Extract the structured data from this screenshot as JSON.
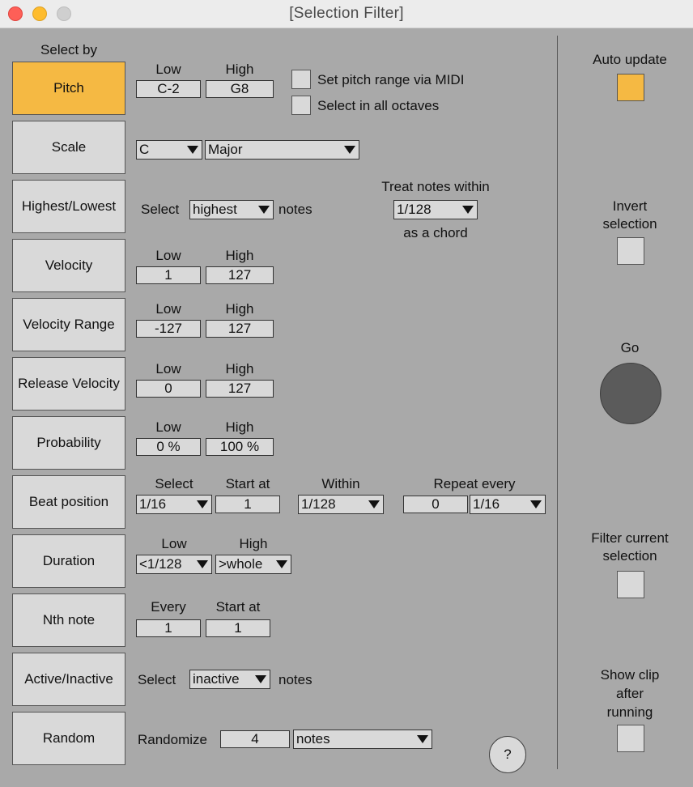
{
  "window": {
    "title": "[Selection Filter]"
  },
  "select_by_label": "Select by",
  "modes": {
    "pitch": "Pitch",
    "scale": "Scale",
    "highest_lowest": "Highest/Lowest",
    "velocity": "Velocity",
    "velocity_range": "Velocity Range",
    "release_velocity": "Release Velocity",
    "probability": "Probability",
    "beat_position": "Beat position",
    "duration": "Duration",
    "nth_note": "Nth note",
    "active_inactive": "Active/Inactive",
    "random": "Random"
  },
  "active_mode": "pitch",
  "labels": {
    "low": "Low",
    "high": "High",
    "select": "Select",
    "notes": "notes",
    "start_at": "Start at",
    "within": "Within",
    "repeat_every": "Repeat every",
    "every": "Every",
    "randomize": "Randomize",
    "treat_within": "Treat notes within",
    "as_chord": "as a chord",
    "set_pitch_midi": "Set pitch range via MIDI",
    "select_all_octaves": "Select in all octaves"
  },
  "pitch": {
    "low": "C-2",
    "high": "G8"
  },
  "scale": {
    "root": "C",
    "mode": "Major"
  },
  "highest_lowest": {
    "select": "highest",
    "chord_window": "1/128"
  },
  "velocity": {
    "low": "1",
    "high": "127"
  },
  "velocity_range": {
    "low": "-127",
    "high": "127"
  },
  "release_velocity": {
    "low": "0",
    "high": "127"
  },
  "probability": {
    "low": "0 %",
    "high": "100 %"
  },
  "beat_position": {
    "select": "1/16",
    "start_at": "1",
    "within": "1/128",
    "repeat_every_count": "0",
    "repeat_every_unit": "1/16"
  },
  "duration": {
    "low": "<1/128",
    "high": ">whole"
  },
  "nth_note": {
    "every": "1",
    "start_at": "1"
  },
  "active_inactive": {
    "select": "inactive"
  },
  "random": {
    "count": "4",
    "unit": "notes"
  },
  "right": {
    "auto_update": "Auto update",
    "invert_selection": "Invert\nselection",
    "go": "Go",
    "filter_current": "Filter current\nselection",
    "show_clip": "Show clip\nafter\nrunning"
  },
  "help": "?",
  "colors": {
    "accent": "#f5b943",
    "panel": "#a9a9a9",
    "control": "#d9d9d9",
    "go": "#5b5b5b"
  }
}
